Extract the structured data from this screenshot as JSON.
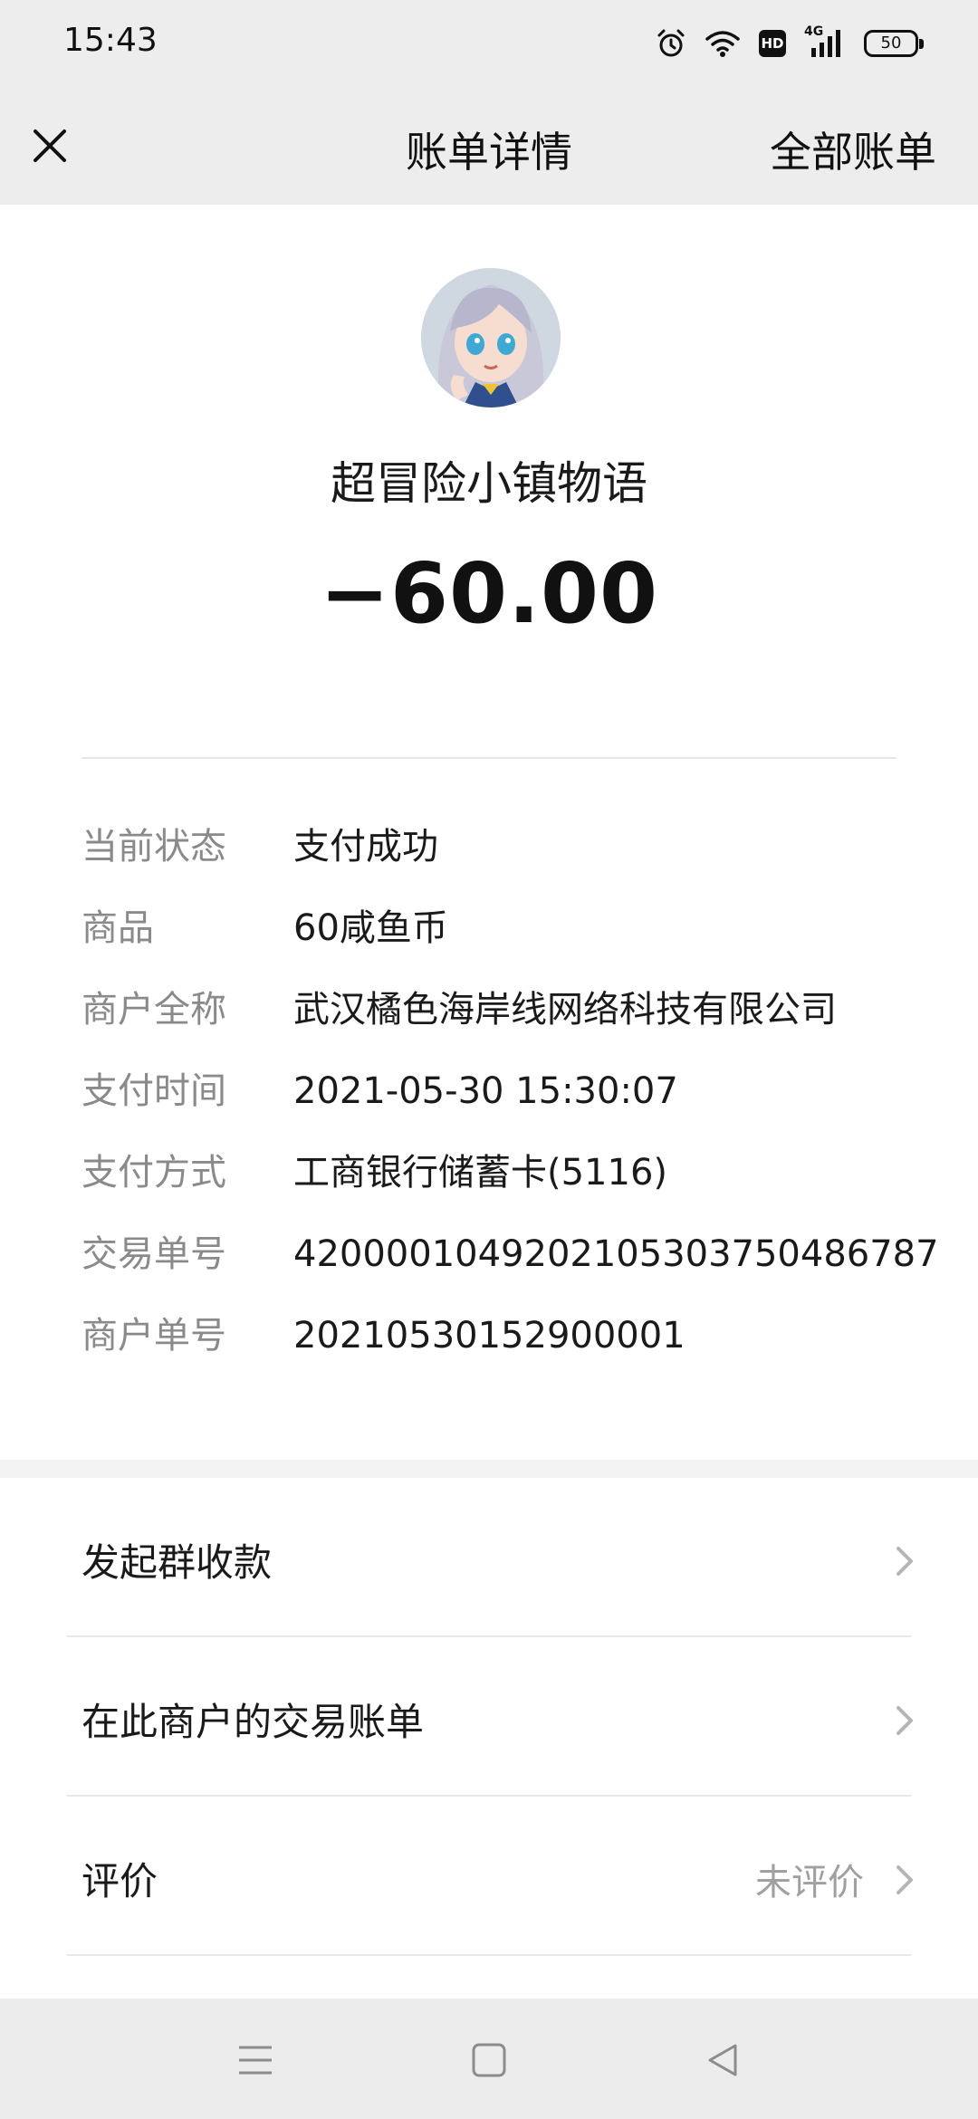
{
  "status_bar": {
    "time": "15:43",
    "network": "4G",
    "hd_badge": "HD",
    "battery": "50"
  },
  "nav": {
    "title": "账单详情",
    "right_action": "全部账单"
  },
  "bill": {
    "merchant_name": "超冒险小镇物语",
    "amount": "−60.00",
    "fields": [
      {
        "label": "当前状态",
        "value": "支付成功"
      },
      {
        "label": "商品",
        "value": "60咸鱼币"
      },
      {
        "label": "商户全称",
        "value": "武汉橘色海岸线网络科技有限公司"
      },
      {
        "label": "支付时间",
        "value": "2021-05-30 15:30:07"
      },
      {
        "label": "支付方式",
        "value": "工商银行储蓄卡(5116)"
      },
      {
        "label": "交易单号",
        "value": "4200001049202105303750486787"
      },
      {
        "label": "商户单号",
        "value": "20210530152900001"
      }
    ]
  },
  "actions": [
    {
      "label": "发起群收款",
      "extra": ""
    },
    {
      "label": "在此商户的交易账单",
      "extra": ""
    },
    {
      "label": "评价",
      "extra": "未评价"
    }
  ],
  "colors": {
    "background": "#ededed",
    "card": "#ffffff",
    "label_gray": "#8a8a8a",
    "text": "#1a1a1a"
  },
  "icons": {
    "close": "close-icon",
    "chevron": "chevron-right-icon",
    "menu": "menu-icon",
    "home": "home-icon",
    "back": "back-icon"
  }
}
